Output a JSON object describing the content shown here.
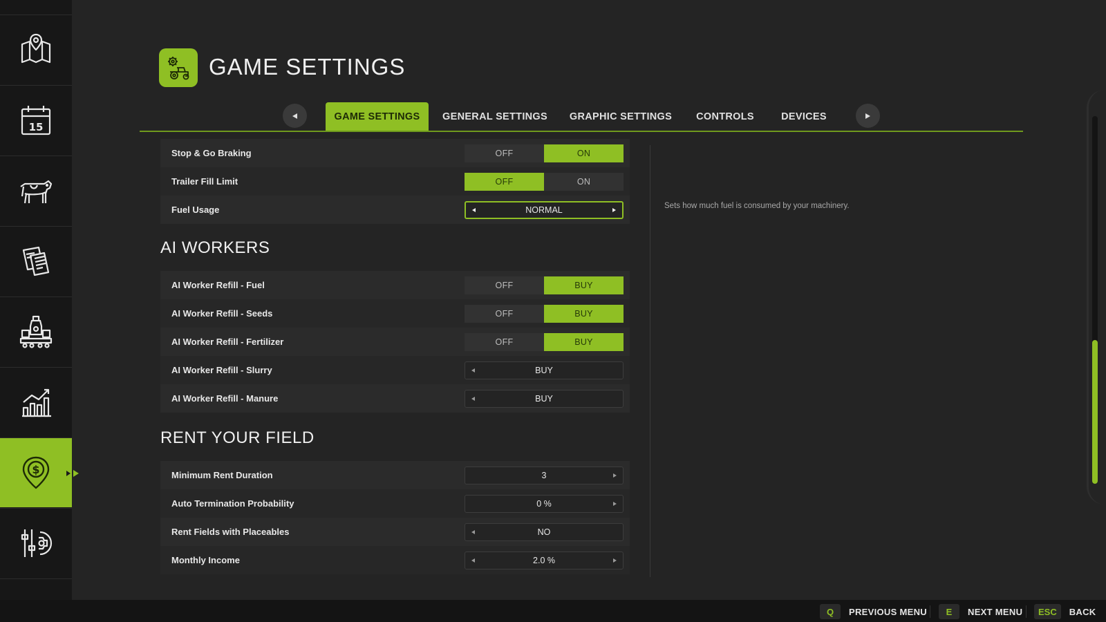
{
  "sidebar": {
    "items": [
      {
        "icon": "map-icon",
        "active": false
      },
      {
        "icon": "calendar-icon",
        "active": false,
        "badge": "15"
      },
      {
        "icon": "cow-icon",
        "active": false
      },
      {
        "icon": "contracts-icon",
        "active": false
      },
      {
        "icon": "production-icon",
        "active": false
      },
      {
        "icon": "statistics-icon",
        "active": false
      },
      {
        "icon": "rent-field-icon",
        "active": true
      },
      {
        "icon": "settings-sliders-icon",
        "active": false
      }
    ]
  },
  "header": {
    "title": "GAME SETTINGS",
    "icon": "tractor-gear-icon"
  },
  "tabs": [
    {
      "label": "GAME SETTINGS",
      "active": true
    },
    {
      "label": "GENERAL SETTINGS",
      "active": false
    },
    {
      "label": "GRAPHIC SETTINGS",
      "active": false
    },
    {
      "label": "CONTROLS",
      "active": false
    },
    {
      "label": "DEVICES",
      "active": false
    }
  ],
  "settings_top": [
    {
      "label": "Stop & Go Braking",
      "type": "toggle",
      "options": [
        "OFF",
        "ON"
      ],
      "selected": "ON"
    },
    {
      "label": "Trailer Fill Limit",
      "type": "toggle",
      "options": [
        "OFF",
        "ON"
      ],
      "selected": "OFF"
    },
    {
      "label": "Fuel Usage",
      "type": "selector",
      "value": "NORMAL",
      "focused": true
    }
  ],
  "ai_workers": {
    "title": "AI WORKERS",
    "items": [
      {
        "label": "AI Worker Refill - Fuel",
        "type": "toggle",
        "options": [
          "OFF",
          "BUY"
        ],
        "selected": "BUY"
      },
      {
        "label": "AI Worker Refill - Seeds",
        "type": "toggle",
        "options": [
          "OFF",
          "BUY"
        ],
        "selected": "BUY"
      },
      {
        "label": "AI Worker Refill - Fertilizer",
        "type": "toggle",
        "options": [
          "OFF",
          "BUY"
        ],
        "selected": "BUY"
      },
      {
        "label": "AI Worker Refill - Slurry",
        "type": "selector",
        "value": "BUY"
      },
      {
        "label": "AI Worker Refill - Manure",
        "type": "selector",
        "value": "BUY"
      }
    ]
  },
  "rent_field": {
    "title": "RENT YOUR FIELD",
    "items": [
      {
        "label": "Minimum Rent Duration",
        "type": "selector",
        "value": "3"
      },
      {
        "label": "Auto Termination Probability",
        "type": "selector",
        "value": "0 %"
      },
      {
        "label": "Rent Fields with Placeables",
        "type": "selector",
        "value": "NO"
      },
      {
        "label": "Monthly Income",
        "type": "selector",
        "value": "2.0 %"
      }
    ]
  },
  "description": "Sets how much fuel is consumed by your machinery.",
  "scrollbar": {
    "position_fraction": 0.61,
    "visible_fraction": 0.39
  },
  "footer": {
    "hints": [
      {
        "key": "Q",
        "label": "PREVIOUS MENU"
      },
      {
        "key": "E",
        "label": "NEXT MENU"
      },
      {
        "key": "ESC",
        "label": "BACK"
      }
    ]
  },
  "colors": {
    "accent": "#8fbf24",
    "background": "#242424",
    "sidebar": "#171717"
  }
}
